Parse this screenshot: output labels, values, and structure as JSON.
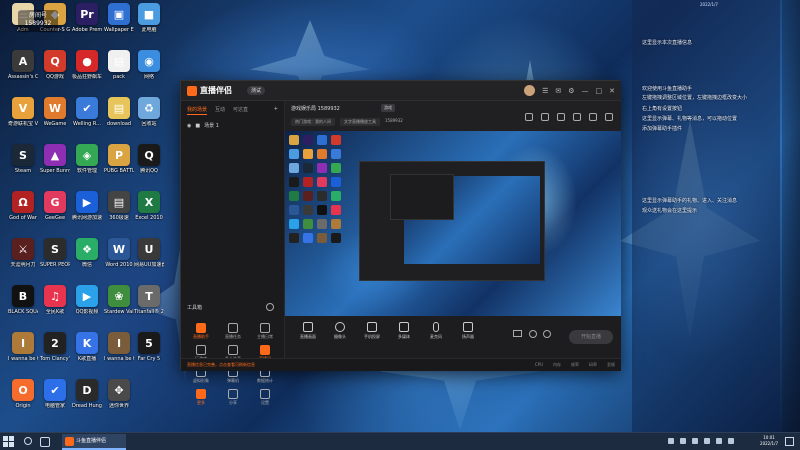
{
  "overlay": {
    "badge_label": "房间号",
    "room_number": "1589932"
  },
  "desktop_icons": [
    {
      "label": "Adm",
      "color": "#e8d6a8",
      "glyph": "☰"
    },
    {
      "label": "Counter-S Global Off...",
      "color": "#d9a441",
      "glyph": "◆"
    },
    {
      "label": "Adobe Premie...",
      "color": "#2b1e63",
      "glyph": "Pr"
    },
    {
      "label": "Wallpaper Engine:...",
      "color": "#2e6fd1",
      "glyph": "▣"
    },
    {
      "label": "此电脑",
      "color": "#4b9be0",
      "glyph": "■"
    },
    {
      "label": "Assassin's Creed V...",
      "color": "#3a3a3a",
      "glyph": "A"
    },
    {
      "label": "QQ游戏",
      "color": "#d23a2a",
      "glyph": "Q"
    },
    {
      "label": "极品狂野飙车 wanna pl...",
      "color": "#d62828",
      "glyph": "●"
    },
    {
      "label": "pack",
      "color": "#f0f0f0",
      "glyph": "▤"
    },
    {
      "label": "网络",
      "color": "#3b8de0",
      "glyph": "◉"
    },
    {
      "label": "奇游联机宝 V...",
      "color": "#e9a23b",
      "glyph": "V"
    },
    {
      "label": "WeGame",
      "color": "#e07b2e",
      "glyph": "W"
    },
    {
      "label": "Welling R...",
      "color": "#3a7ad9",
      "glyph": "✔"
    },
    {
      "label": "download",
      "color": "#e8c55a",
      "glyph": "▤"
    },
    {
      "label": "回收站",
      "color": "#6fa8dc",
      "glyph": "♻"
    },
    {
      "label": "Steam",
      "color": "#1b2838",
      "glyph": "S"
    },
    {
      "label": "Super Bunny Man",
      "color": "#8e2fb3",
      "glyph": "▲"
    },
    {
      "label": "软件管理",
      "color": "#34a853",
      "glyph": "◈"
    },
    {
      "label": "PUBG BATTLEG...",
      "color": "#d9a441",
      "glyph": "P"
    },
    {
      "label": "腾讯QQ",
      "color": "#1a1a1a",
      "glyph": "Q"
    },
    {
      "label": "God of War",
      "color": "#b22222",
      "glyph": "Ω"
    },
    {
      "label": "GeeGee",
      "color": "#e23a5e",
      "glyph": "G"
    },
    {
      "label": "腾讯网游加速",
      "color": "#1b5fd9",
      "glyph": "▶"
    },
    {
      "label": "360极速",
      "color": "#444",
      "glyph": "▤"
    },
    {
      "label": "Excel 2010",
      "color": "#1f7a43",
      "glyph": "X"
    },
    {
      "label": "天涯明月刀",
      "color": "#5a1f1f",
      "glyph": "⚔"
    },
    {
      "label": "SUPER PEOPLE CBT",
      "color": "#2c2c2c",
      "glyph": "S"
    },
    {
      "label": "微信",
      "color": "#2aae67",
      "glyph": "❖"
    },
    {
      "label": "Word 2010",
      "color": "#2b5797",
      "glyph": "W"
    },
    {
      "label": "网易UU加速器",
      "color": "#3a3a3a",
      "glyph": "U"
    },
    {
      "label": "BLACK SQUAD",
      "color": "#111",
      "glyph": "B"
    },
    {
      "label": "全民K歌",
      "color": "#e8344e",
      "glyph": "♫"
    },
    {
      "label": "QQ影视频",
      "color": "#2aa1e8",
      "glyph": "▶"
    },
    {
      "label": "Stardew Valley",
      "color": "#3e8e3e",
      "glyph": "❀"
    },
    {
      "label": "Titanfall® 2",
      "color": "#6b6b6b",
      "glyph": "T"
    },
    {
      "label": "I wanna be the GUY...",
      "color": "#ad7a3a",
      "glyph": "I"
    },
    {
      "label": "Tom Clancy's T...",
      "color": "#222",
      "glyph": "2"
    },
    {
      "label": "K歌直播",
      "color": "#3573e6",
      "glyph": "K"
    },
    {
      "label": "I wanna be the Creator",
      "color": "#7a5b3a",
      "glyph": "I"
    },
    {
      "label": "Far Cry 5",
      "color": "#1a1a1a",
      "glyph": "5"
    },
    {
      "label": "Origin",
      "color": "#f56c2d",
      "glyph": "O"
    },
    {
      "label": "电脑管家",
      "color": "#2d6fe8",
      "glyph": "✔"
    },
    {
      "label": "Dread Hunger",
      "color": "#2a2a2a",
      "glyph": "D"
    },
    {
      "label": "迷你世界",
      "color": "#4a4a4a",
      "glyph": "✥"
    }
  ],
  "chat": {
    "time": "2022/1/7",
    "lines": [
      "这里显示本次直播信息",
      "欢迎使用斗鱼直播助手",
      "左键拖拽调整区域位置，左键拖拽边框改变大小",
      "右上角有设置按钮",
      "这里显示弹幕、礼物等消息，可以拖动位置",
      "添加弹幕助手插件",
      "这里显示弹幕助手的礼物、进入、关注消息",
      "观众送礼物会在这里提示"
    ]
  },
  "app": {
    "name": "直播伴侣",
    "version": "测试",
    "left_tabs": [
      "我的场景",
      "互动",
      "可达直"
    ],
    "scene_label": "场景 1",
    "tools_title": "工具箱",
    "tools": [
      {
        "label": "直播助手",
        "hot": true
      },
      {
        "label": "直播任务",
        "hot": false
      },
      {
        "label": "主播日常",
        "hot": false
      },
      {
        "label": "玩游戏",
        "hot": false
      },
      {
        "label": "多人连麦",
        "hot": false
      },
      {
        "label": "直播间",
        "hot": true
      },
      {
        "label": "虚拟形象",
        "hot": false
      },
      {
        "label": "弹幕机",
        "hot": false
      },
      {
        "label": "数据统计",
        "hot": false
      },
      {
        "label": "更多",
        "hot": true
      },
      {
        "label": "分享",
        "hot": false
      },
      {
        "label": "设置",
        "hot": false
      }
    ],
    "room_title": "游戏娱乐局 1589932",
    "room_badge": "游戏",
    "room_pills": [
      "热门游戏：我的人间",
      "文字直播播放工具",
      "1589932"
    ],
    "bottom_buttons": [
      "直播画面",
      "摄像头",
      "手机投屏",
      "多媒体",
      "麦克风",
      "扬声器"
    ],
    "start_live": "开始直播",
    "status_left": "直播信息已完善，点击查看可刷新信息",
    "status_right": [
      "CPU",
      "内存",
      "帧率",
      "码率",
      "丢帧"
    ]
  },
  "taskbar": {
    "app_label": "斗鱼直播伴侣",
    "time": "10:01",
    "date": "2022/1/7"
  }
}
